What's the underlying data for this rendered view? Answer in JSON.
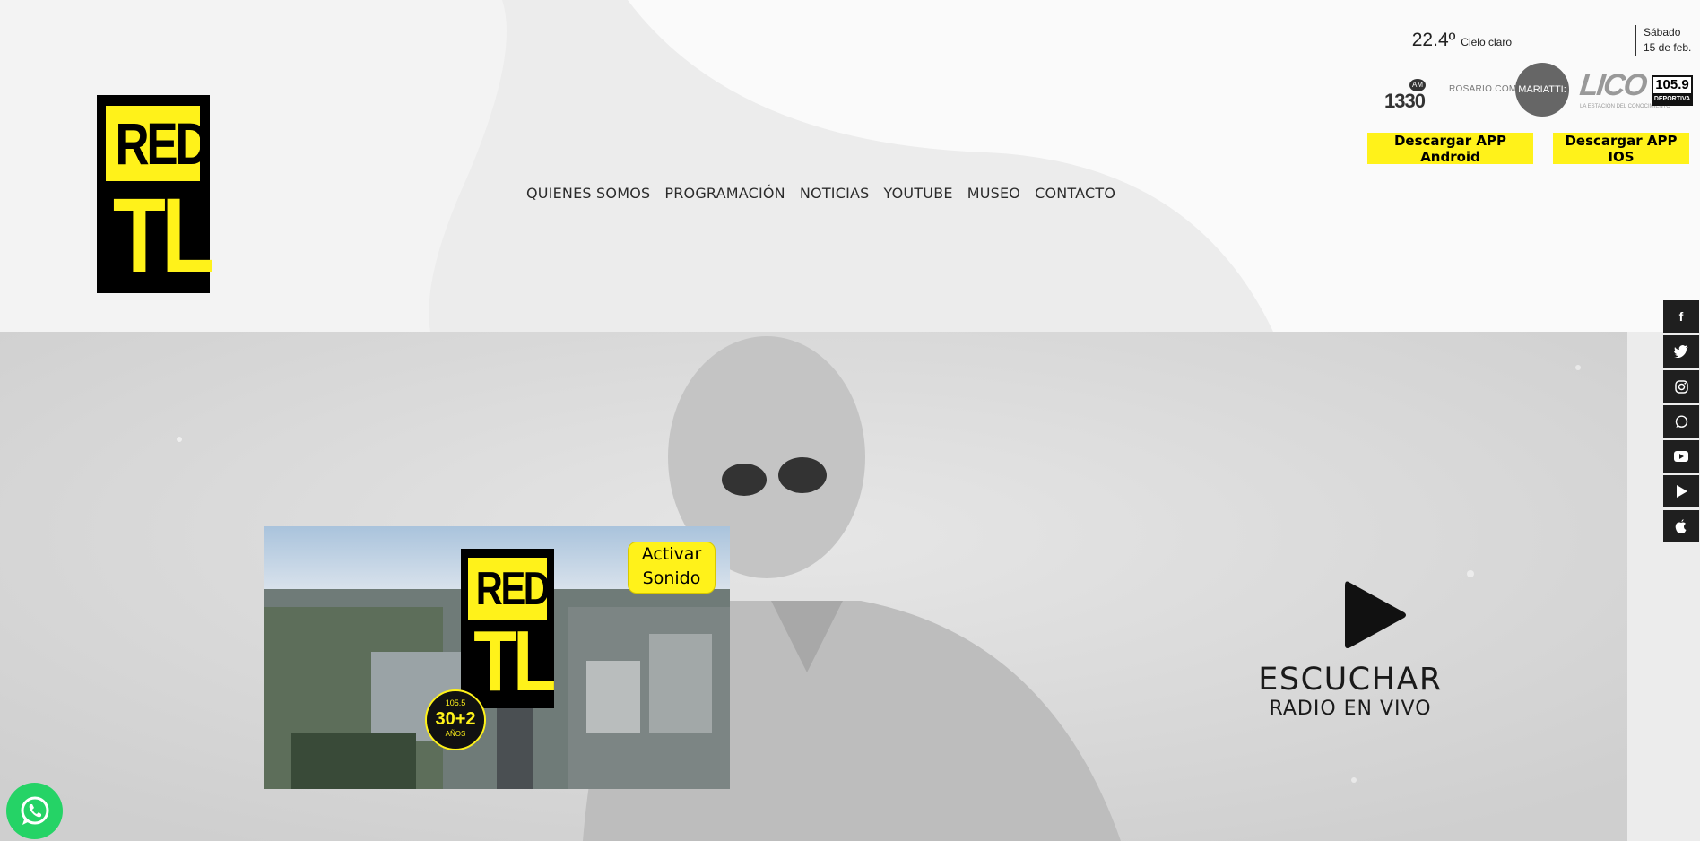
{
  "logo": {
    "line1": "RED",
    "line2": "TL"
  },
  "nav": {
    "items": [
      {
        "label": "QUIENES SOMOS"
      },
      {
        "label": "PROGRAMACIÓN"
      },
      {
        "label": "NOTICIAS"
      },
      {
        "label": "YOUTUBE"
      },
      {
        "label": "MUSEO"
      },
      {
        "label": "CONTACTO"
      }
    ]
  },
  "weather": {
    "temp": "22.4º",
    "desc": "Cielo claro",
    "day": "Sábado",
    "date": "15 de feb."
  },
  "partners": {
    "am1330": {
      "am": "AM",
      "num": "1330"
    },
    "rosario": "ROSARIO.COM",
    "mariatti": "MARIATTI:",
    "lico": "LICO",
    "lico_sub": "LA ESTACIÓN DEL CONOCIMIENTO",
    "deportiva": {
      "num": "105.9",
      "label": "DEPORTIVA"
    }
  },
  "buttons": {
    "android": "Descargar APP Android",
    "ios": "Descargar APP IOS"
  },
  "video": {
    "activar": "Activar Sonido",
    "badge": {
      "top": "105.5",
      "mid": "30+2",
      "bottom": "AÑOS"
    }
  },
  "listen": {
    "line1": "ESCUCHAR",
    "line2": "RADIO EN VIVO"
  },
  "social": [
    {
      "icon": "facebook-icon",
      "glyph": "f"
    },
    {
      "icon": "twitter-icon",
      "glyph": "🐦"
    },
    {
      "icon": "instagram-icon",
      "glyph": "◎"
    },
    {
      "icon": "whatsapp-icon",
      "glyph": "✆"
    },
    {
      "icon": "youtube-icon",
      "glyph": "▶"
    },
    {
      "icon": "google-play-icon",
      "glyph": "▷"
    },
    {
      "icon": "apple-icon",
      "glyph": ""
    }
  ],
  "colors": {
    "accent": "#fff21a",
    "dark": "#1f1f1f",
    "whatsapp": "#25d366"
  }
}
